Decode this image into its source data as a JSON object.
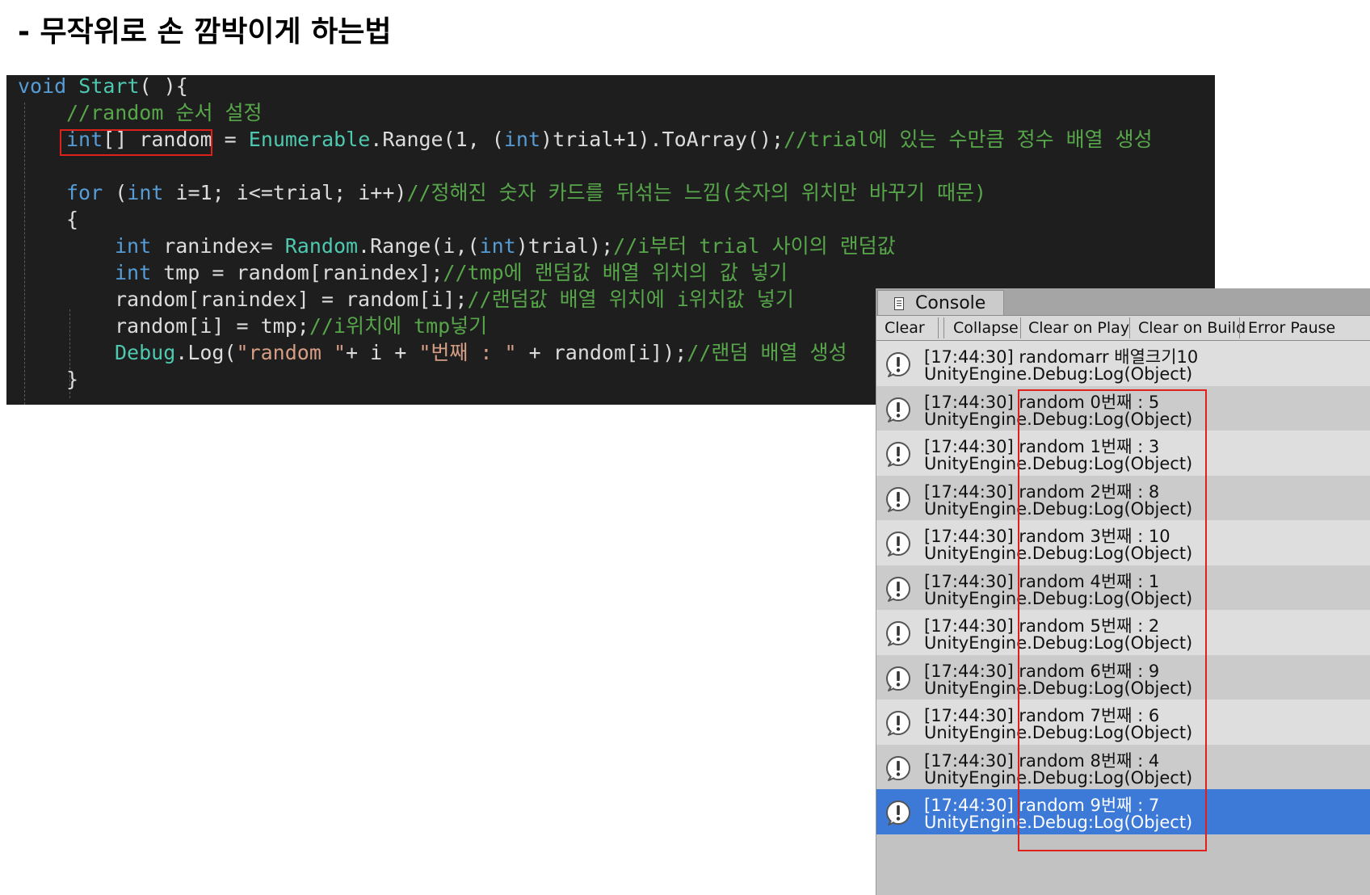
{
  "page_title": "- 무작위로 손 깜박이게 하는법",
  "code": {
    "line1": {
      "kw": "void",
      "ty": "Start",
      "rest": "( ){"
    },
    "line2": {
      "cm": "//random 순서 설정"
    },
    "line3": {
      "kw1": "int",
      "p1": "[] random",
      "p2": " = ",
      "ty": "Enumerable",
      "p3": ".Range(1, (",
      "kw2": "int",
      "p4": ")trial+1).ToArray();",
      "cm": "//trial에 있는 수만큼 정수 배열 생성"
    },
    "line5": {
      "kw1": "for",
      "p1": " (",
      "kw2": "int",
      "p2": " i=1; i<=trial; i++)",
      "cm": "//정해진 숫자 카드를 뒤섞는 느낌(숫자의 위치만 바꾸기 때문)"
    },
    "line6": {
      "p1": "{"
    },
    "line7": {
      "kw1": "int",
      "p1": " ranindex= ",
      "ty": "Random",
      "p2": ".Range(i,(",
      "kw2": "int",
      "p3": ")trial);",
      "cm": "//i부터 trial 사이의 랜덤값"
    },
    "line8": {
      "kw1": "int",
      "p1": " tmp = random[ranindex];",
      "cm": "//tmp에 랜덤값 배열 위치의 값 넣기"
    },
    "line9": {
      "p1": "random[ranindex] = random[i];",
      "cm": "//랜덤값 배열 위치에 i위치값 넣기"
    },
    "line10": {
      "p1": "random[i] = tmp;",
      "cm": "//i위치에 tmp넣기"
    },
    "line11": {
      "ty": "Debug",
      "p1": ".Log(",
      "st1": "\"random \"",
      "p2": "+ i + ",
      "st2": "\"번째 : \"",
      "p3": " + random[i]);",
      "cm": "//랜덤 배열 생성"
    },
    "line12": {
      "p1": "}"
    }
  },
  "console": {
    "tab_label": "Console",
    "toolbar": {
      "clear": "Clear",
      "collapse": "Collapse",
      "clear_on_play": "Clear on Play",
      "clear_on_build": "Clear on Build",
      "error_pause": "Error Pause"
    },
    "entries": [
      {
        "line1": "[17:44:30] randomarr 배열크기10",
        "line2": "UnityEngine.Debug:Log(Object)"
      },
      {
        "line1": "[17:44:30] random 0번째 : 5",
        "line2": "UnityEngine.Debug:Log(Object)"
      },
      {
        "line1": "[17:44:30] random 1번째 : 3",
        "line2": "UnityEngine.Debug:Log(Object)"
      },
      {
        "line1": "[17:44:30] random 2번째 : 8",
        "line2": "UnityEngine.Debug:Log(Object)"
      },
      {
        "line1": "[17:44:30] random 3번째 : 10",
        "line2": "UnityEngine.Debug:Log(Object)"
      },
      {
        "line1": "[17:44:30] random 4번째 : 1",
        "line2": "UnityEngine.Debug:Log(Object)"
      },
      {
        "line1": "[17:44:30] random 5번째 : 2",
        "line2": "UnityEngine.Debug:Log(Object)"
      },
      {
        "line1": "[17:44:30] random 6번째 : 9",
        "line2": "UnityEngine.Debug:Log(Object)"
      },
      {
        "line1": "[17:44:30] random 7번째 : 6",
        "line2": "UnityEngine.Debug:Log(Object)"
      },
      {
        "line1": "[17:44:30] random 8번째 : 4",
        "line2": "UnityEngine.Debug:Log(Object)"
      },
      {
        "line1": "[17:44:30] random 9번째 : 7",
        "line2": "UnityEngine.Debug:Log(Object)"
      }
    ],
    "selected_index": 10
  },
  "colors": {
    "editor_bg": "#1e1e1e",
    "keyword": "#569cd6",
    "type": "#4ec9b0",
    "comment": "#57a64a",
    "string": "#d69d85",
    "highlight_box": "#e0201a",
    "selection": "#3d7ad8"
  }
}
